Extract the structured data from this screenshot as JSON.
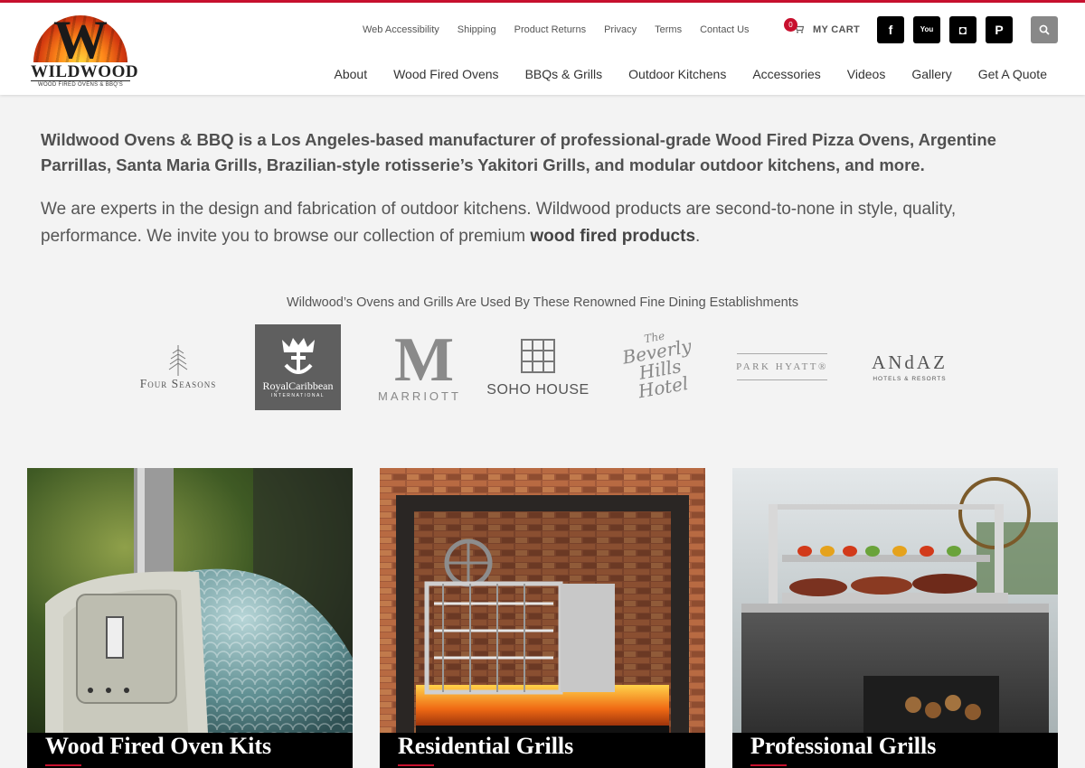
{
  "logo": {
    "mark_letter": "W",
    "name": "WILDWOOD",
    "tagline": "WOOD FIRED OVENS & BBQ'S"
  },
  "utility_nav": [
    "Web Accessibility",
    "Shipping",
    "Product Returns",
    "Privacy",
    "Terms",
    "Contact Us"
  ],
  "cart": {
    "count": "0",
    "label": "MY CART"
  },
  "social": [
    {
      "name": "facebook",
      "glyph": "f"
    },
    {
      "name": "youtube",
      "glyph": "You"
    },
    {
      "name": "instagram",
      "glyph": "◘"
    },
    {
      "name": "pinterest",
      "glyph": "P"
    }
  ],
  "main_nav": [
    "About",
    "Wood Fired Ovens",
    "BBQs & Grills",
    "Outdoor Kitchens",
    "Accessories",
    "Videos",
    "Gallery",
    "Get A Quote"
  ],
  "intro": {
    "lead": "Wildwood Ovens & BBQ is a Los Angeles-based manufacturer of professional-grade Wood Fired Pizza Ovens, Argentine Parrillas, Santa Maria Grills, Brazilian-style rotisserie’s  Yakitori Grills, and modular outdoor kitchens, and more.",
    "body_text": "We are experts in the design and fabrication of outdoor kitchens. Wildwood products are second-to-none in style, quality, performance. We invite you to browse our collection of premium",
    "body_link": "wood fired products",
    "body_end": "."
  },
  "establishments": {
    "heading": "Wildwood’s Ovens and Grills Are Used By These Renowned Fine Dining Establishments",
    "four_seasons": "Four Seasons",
    "royal_caribbean": {
      "name": "RoyalCaribbean",
      "sub": "INTERNATIONAL"
    },
    "marriott": {
      "mark": "M",
      "name": "MARRIOTT"
    },
    "soho_house": "SOHO HOUSE",
    "beverly_hills": {
      "line1": "The",
      "line2": "Beverly Hills",
      "line3": "Hotel"
    },
    "park_hyatt": "PARK HYATT®",
    "andaz": {
      "name": "ANdAZ",
      "sub": "HOTELS & RESORTS"
    }
  },
  "cards": [
    {
      "title": "Wood Fired Oven Kits"
    },
    {
      "title": "Residential Grills"
    },
    {
      "title": "Professional Grills"
    }
  ],
  "colors": {
    "accent": "#c8102e",
    "background": "#f3f3f3",
    "header_bg": "#ffffff",
    "icon_bg": "#000000",
    "search_bg": "#888888"
  }
}
